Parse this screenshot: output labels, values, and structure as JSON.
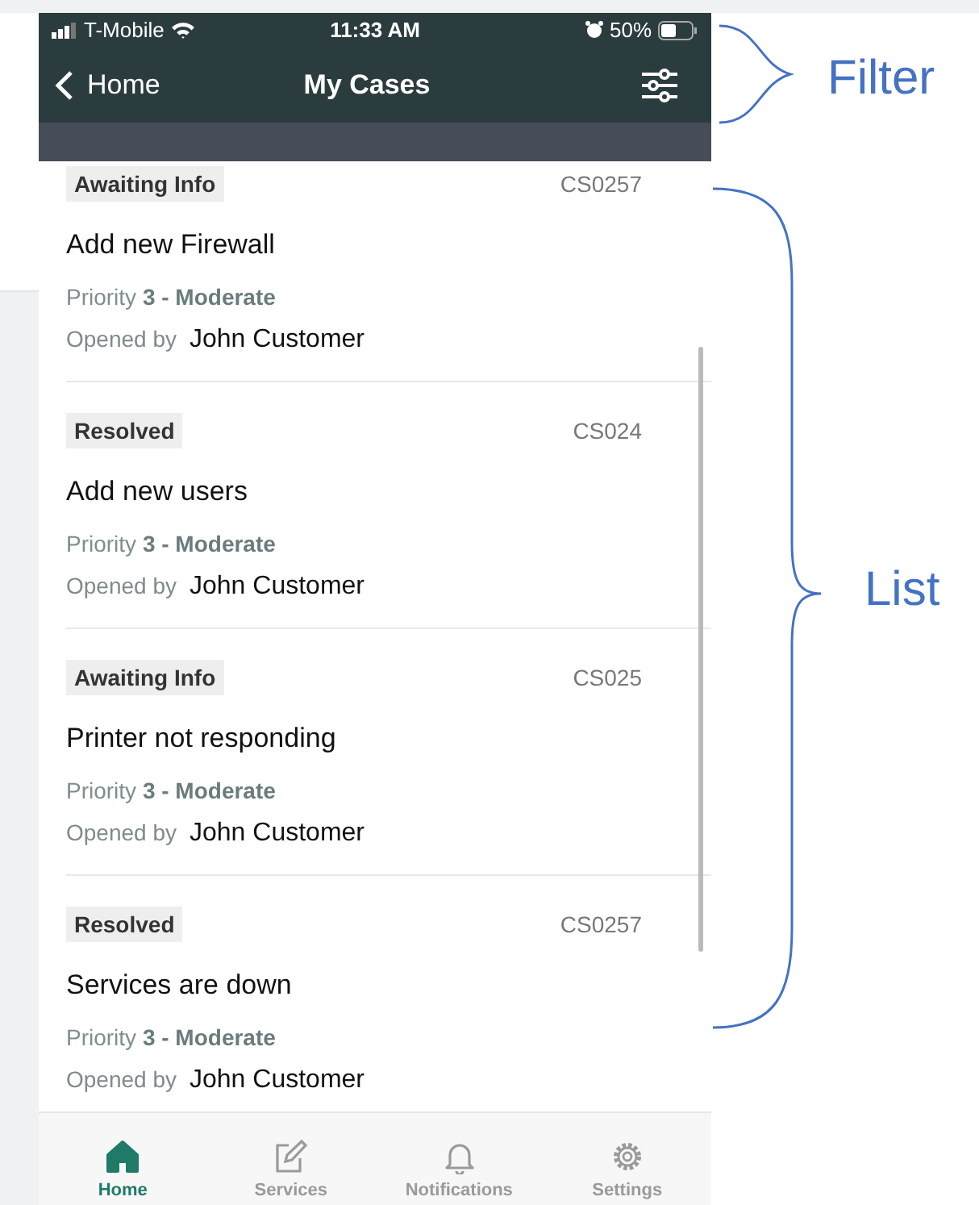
{
  "status_bar": {
    "carrier": "T-Mobile",
    "time": "11:33 AM",
    "battery": "50%"
  },
  "nav": {
    "back": "Home",
    "title": "My Cases"
  },
  "cases": [
    {
      "status": "Awaiting Info",
      "number": "CS0257",
      "title": "Add new Firewall",
      "priority_label": "Priority",
      "priority": "3 - Moderate",
      "opened_label": "Opened by",
      "opened_by": "John Customer"
    },
    {
      "status": "Resolved",
      "number": "CS024",
      "title": "Add new users",
      "priority_label": "Priority",
      "priority": "3 - Moderate",
      "opened_label": "Opened by",
      "opened_by": "John Customer"
    },
    {
      "status": "Awaiting Info",
      "number": "CS025",
      "title": "Printer not responding",
      "priority_label": "Priority",
      "priority": "3 - Moderate",
      "opened_label": "Opened by",
      "opened_by": "John Customer"
    },
    {
      "status": "Resolved",
      "number": "CS0257",
      "title": "Services are down",
      "priority_label": "Priority",
      "priority": "3 - Moderate",
      "opened_label": "Opened by",
      "opened_by": "John Customer"
    }
  ],
  "tabs": [
    {
      "label": "Home",
      "kind": "home",
      "selected": true
    },
    {
      "label": "Services",
      "kind": "edit",
      "selected": false
    },
    {
      "label": "Notifications",
      "kind": "bell",
      "selected": false
    },
    {
      "label": "Settings",
      "kind": "gear",
      "selected": false
    }
  ],
  "annotations": [
    {
      "kind": "filter",
      "label": "Filter"
    },
    {
      "kind": "list",
      "label": "List"
    }
  ]
}
